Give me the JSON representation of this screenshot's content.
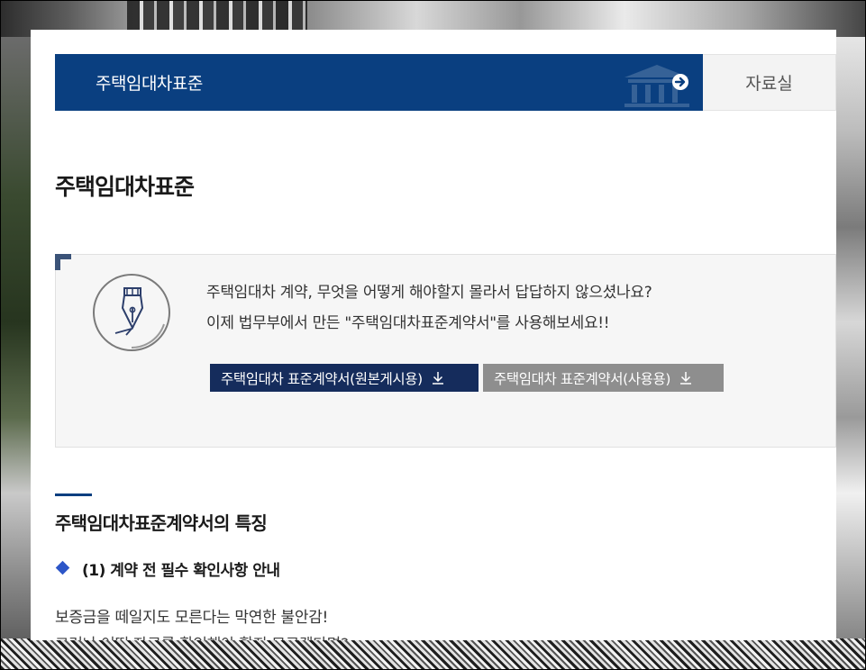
{
  "navbar": {
    "active_label": "주택임대차표준",
    "other_label": "자료실"
  },
  "page_title": "주택임대차표준",
  "intro": {
    "line1": "주택임대차 계약, 무엇을 어떻게 해야할지 몰라서 답답하지 않으셨나요?",
    "line2": "이제 법무부에서 만든 \"주택임대차표준계약서\"를 사용해보세요!!"
  },
  "buttons": {
    "original_label": "주택임대차 표준계약서(원본게시용)",
    "usage_label": "주택임대차 표준계약서(사용용)"
  },
  "section": {
    "title": "주택임대차표준계약서의 특징",
    "subtitle": "(1) 계약 전 필수 확인사항 안내",
    "body_line1": "보증금을 떼일지도 모른다는 막연한 불안감!",
    "body_line2": "그러나 어떤 자료를 확인해야 할지 모르겠다면?"
  },
  "colors": {
    "brand_navy": "#0a3f80",
    "button_navy": "#152c5c",
    "button_gray": "#8e8e8e",
    "bullet_blue": "#2d56c8"
  },
  "icons": [
    "bank-icon",
    "arrow-right-circle-icon",
    "fountain-pen-icon",
    "download-icon",
    "diamond-bullet-icon"
  ]
}
